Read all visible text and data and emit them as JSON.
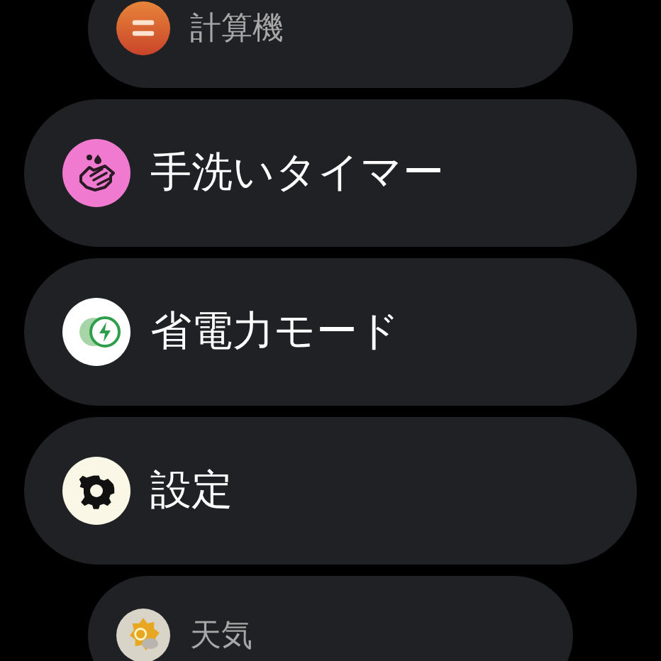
{
  "apps": [
    {
      "kind": "calculator",
      "label": "計算機",
      "dimmed": true
    },
    {
      "kind": "handwash",
      "label": "手洗いタイマー",
      "dimmed": false
    },
    {
      "kind": "battery-saver",
      "label": "省電力モード",
      "dimmed": false
    },
    {
      "kind": "settings",
      "label": "設定",
      "dimmed": false
    },
    {
      "kind": "weather",
      "label": "天気",
      "dimmed": true
    }
  ]
}
